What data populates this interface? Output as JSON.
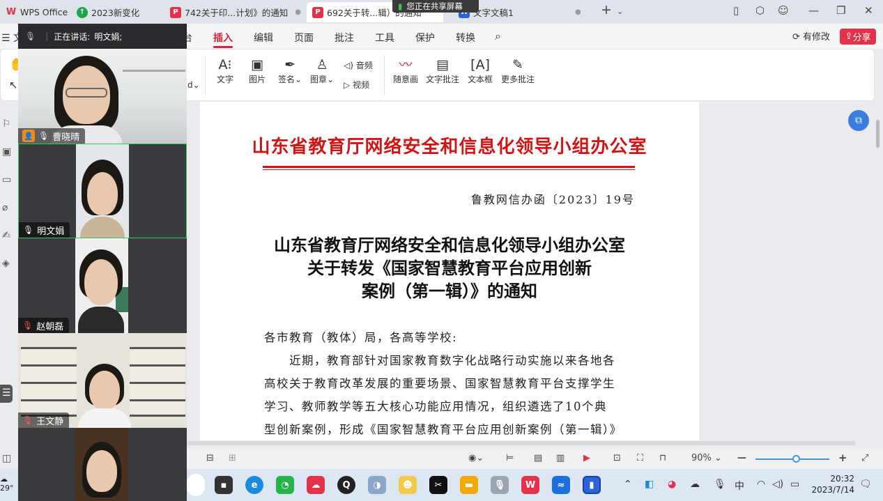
{
  "tabs": [
    {
      "label": "WPS Office",
      "icon": "wps-logo-icon"
    },
    {
      "label": "2023新变化",
      "icon": "green-arrow-icon"
    },
    {
      "label": "742关于印...计划》的通知",
      "icon": "wps-pdf-icon"
    },
    {
      "label": "692关于转...辑）的通知",
      "icon": "wps-pdf-icon"
    },
    {
      "label": "文字文稿1",
      "icon": "wps-doc-icon"
    }
  ],
  "share_banner": "您正在共享屏幕",
  "menu": {
    "file_label": "文",
    "items": [
      "插入",
      "编辑",
      "页面",
      "批注",
      "工具",
      "保护",
      "转换"
    ],
    "active_index": 0,
    "cut_item": "台",
    "modified_label": "有修改",
    "share_label": "分享"
  },
  "ribbon": {
    "text_label": "文字",
    "image_label": "图片",
    "signature_label": "签名",
    "stamp_label": "图章",
    "audio_label": "音频",
    "video_label": "视频",
    "freehand_label": "随意画",
    "text_comment_label": "文字批注",
    "textbox_label": "文本框",
    "more_comments_label": "更多批注",
    "dropdown_cut": "d"
  },
  "document": {
    "header_title": "山东省教育厅网络安全和信息化领导小组办公室",
    "doc_number": "鲁教网信办函〔2023〕19号",
    "title_lines": [
      "山东省教育厅网络安全和信息化领导小组办公室",
      "关于转发《国家智慧教育平台应用创新",
      "案例（第一辑）》的通知"
    ],
    "salutation": "各市教育（教体）局，各高等学校:",
    "body_lines": [
      "近期，教育部针对国家教育数字化战略行动实施以来各地各",
      "高校关于教育改革发展的重要场景、国家智慧教育平台支撑学生",
      "学习、教师教学等五大核心功能应用情况，组织遴选了10个典",
      "型创新案例，形成《国家智慧教育平台应用创新案例（第一辑）》"
    ]
  },
  "status": {
    "zoom": "90%",
    "zoom_level": 0.55
  },
  "meeting": {
    "speaking_label": "正在讲话:",
    "speaker": "明文娟;",
    "participants": [
      {
        "name": "曹晓晴",
        "host": true,
        "muted": false
      },
      {
        "name": "明文娟",
        "host": false,
        "muted": false
      },
      {
        "name": "赵朝磊",
        "host": false,
        "muted": true
      },
      {
        "name": "王文静",
        "host": false,
        "muted": true
      }
    ]
  },
  "taskbar": {
    "weather": "29°",
    "time": "20:32",
    "date": "2023/7/14",
    "ime": "中"
  },
  "colors": {
    "accent_red": "#d6243a",
    "doc_red": "#d01515",
    "meeting_bg": "#2a2b2e",
    "speaking_green": "#35c759"
  }
}
